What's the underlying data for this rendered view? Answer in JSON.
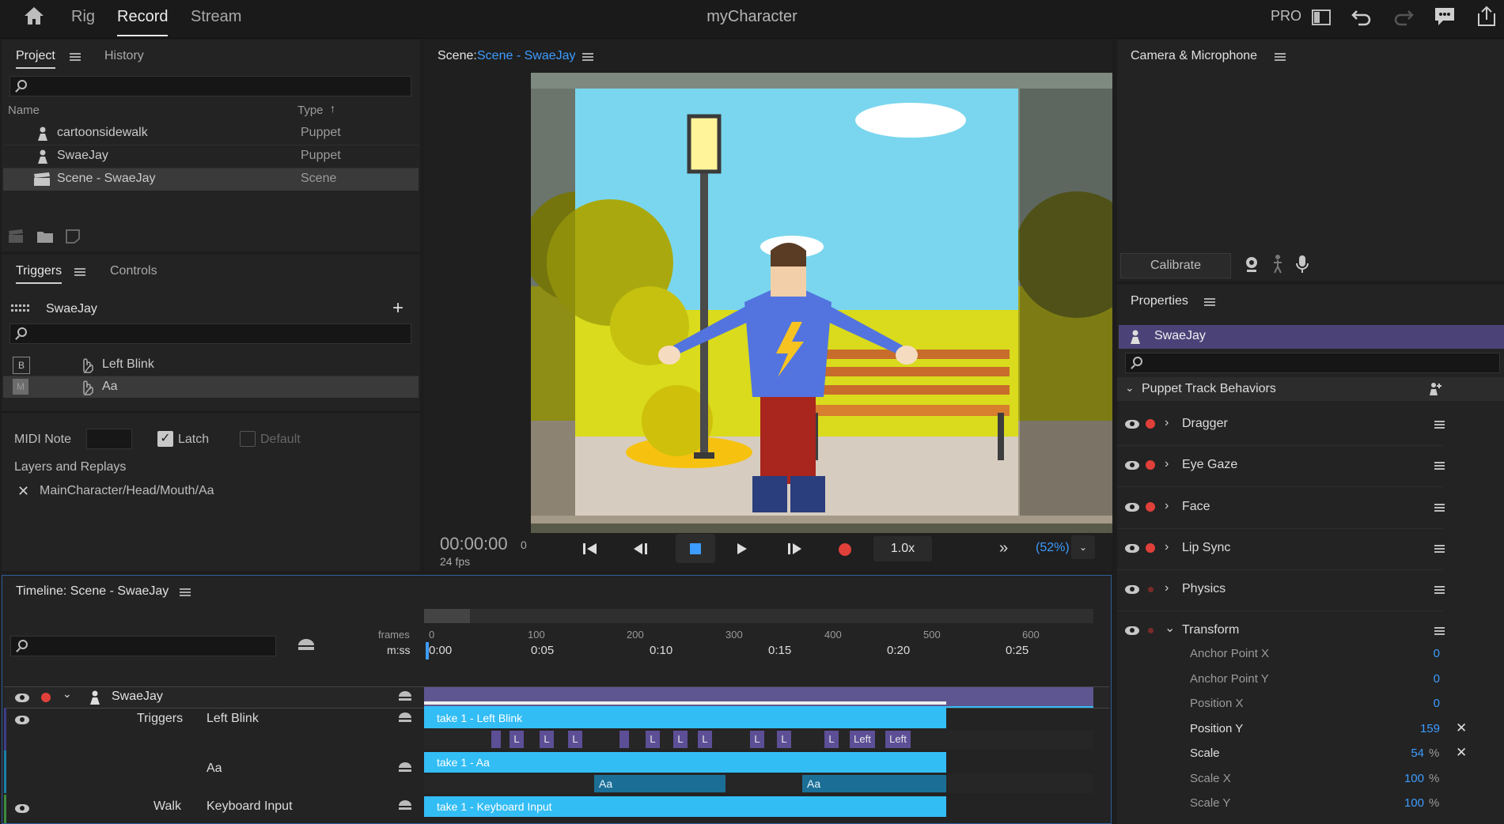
{
  "topbar": {
    "nav": [
      "Rig",
      "Record",
      "Stream"
    ],
    "active_nav": "Record",
    "title": "myCharacter",
    "pro_label": "PRO"
  },
  "project_panel": {
    "tabs": [
      "Project",
      "History"
    ],
    "search_placeholder": "",
    "columns": {
      "name": "Name",
      "type": "Type"
    },
    "items": [
      {
        "name": "cartoonsidewalk",
        "type": "Puppet",
        "icon": "puppet-icon",
        "selected": false
      },
      {
        "name": "SwaeJay",
        "type": "Puppet",
        "icon": "puppet-icon",
        "selected": false
      },
      {
        "name": "Scene - SwaeJay",
        "type": "Scene",
        "icon": "scene-icon",
        "selected": true
      }
    ]
  },
  "triggers_panel": {
    "tabs": [
      "Triggers",
      "Controls"
    ],
    "puppet": "SwaeJay",
    "search_placeholder": "",
    "triggers": [
      {
        "key": "B",
        "name": "Left Blink",
        "selected": false
      },
      {
        "key": "M",
        "name": "Aa",
        "selected": true
      }
    ],
    "midi_label": "MIDI Note",
    "midi_value": "",
    "latch_label": "Latch",
    "latch_checked": true,
    "default_label": "Default",
    "default_checked": false,
    "layers_label": "Layers and Replays",
    "layer_path": "MainCharacter/Head/Mouth/Aa"
  },
  "scene_panel": {
    "label": "Scene:",
    "scene_name": "Scene - SwaeJay",
    "timecode": "00:00:00",
    "frame": "0",
    "fps": "24 fps",
    "speed": "1.0x",
    "zoom": "(52%)"
  },
  "camera_panel": {
    "title": "Camera & Microphone",
    "calibrate_label": "Calibrate"
  },
  "properties_panel": {
    "title": "Properties",
    "puppet": "SwaeJay",
    "section": "Puppet Track Behaviors",
    "behaviors": [
      {
        "name": "Dragger",
        "expanded": false,
        "armed": true
      },
      {
        "name": "Eye Gaze",
        "expanded": false,
        "armed": true
      },
      {
        "name": "Face",
        "expanded": false,
        "armed": true
      },
      {
        "name": "Lip Sync",
        "expanded": false,
        "armed": true
      },
      {
        "name": "Physics",
        "expanded": false,
        "armed": false
      },
      {
        "name": "Transform",
        "expanded": true,
        "armed": false
      }
    ],
    "transform_params": [
      {
        "name": "Anchor Point X",
        "value": "0",
        "unit": "",
        "modified": false
      },
      {
        "name": "Anchor Point Y",
        "value": "0",
        "unit": "",
        "modified": false
      },
      {
        "name": "Position X",
        "value": "0",
        "unit": "",
        "modified": false
      },
      {
        "name": "Position Y",
        "value": "159",
        "unit": "",
        "modified": true
      },
      {
        "name": "Scale",
        "value": "54",
        "unit": "%",
        "modified": true
      },
      {
        "name": "Scale X",
        "value": "100",
        "unit": "%",
        "modified": false
      },
      {
        "name": "Scale Y",
        "value": "100",
        "unit": "%",
        "modified": false
      }
    ]
  },
  "timeline": {
    "title": "Timeline: Scene - SwaeJay",
    "frames_label": "frames",
    "mss_label": "m:ss",
    "frame_ticks": [
      "0",
      "100",
      "200",
      "300",
      "400",
      "500",
      "600"
    ],
    "time_ticks": [
      "0:00",
      "0:05",
      "0:10",
      "0:15",
      "0:20",
      "0:25"
    ],
    "puppet": "SwaeJay",
    "tracks": [
      {
        "group": "Triggers",
        "name": "Left Blink",
        "clip": "take 1 - Left Blink"
      },
      {
        "group": "",
        "name": "Aa",
        "clip": "take 1 - Aa"
      },
      {
        "group": "Walk",
        "name": "Keyboard Input",
        "clip": "take 1 - Keyboard Input"
      }
    ],
    "blink_marks": [
      "L",
      "L",
      "L",
      "L",
      "L",
      "L",
      "L",
      "L",
      "L",
      "Left",
      "Left"
    ],
    "aa_marks": [
      "Aa",
      "Aa"
    ]
  }
}
